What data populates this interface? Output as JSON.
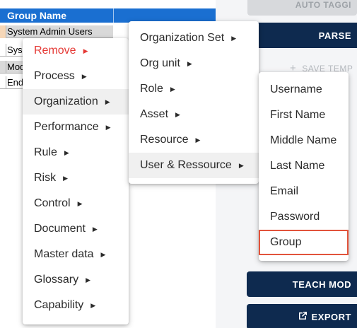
{
  "sheet": {
    "header": "Group Name",
    "rows": [
      "System Admin Users",
      "Sys",
      "Mod",
      "End"
    ]
  },
  "panel": {
    "auto_tagging_label": "AUTO TAGGI",
    "parse_label": "PARSE",
    "save_template_label": "SAVE TEMP",
    "teach_label": "TEACH MOD",
    "export_label": "EXPORT"
  },
  "menus": {
    "main": [
      {
        "label": "Remove",
        "style": "danger"
      },
      {
        "label": "Process"
      },
      {
        "label": "Organization",
        "hover": true
      },
      {
        "label": "Performance"
      },
      {
        "label": "Rule"
      },
      {
        "label": "Risk"
      },
      {
        "label": "Control"
      },
      {
        "label": "Document"
      },
      {
        "label": "Master data"
      },
      {
        "label": "Glossary"
      },
      {
        "label": "Capability"
      }
    ],
    "organization": [
      {
        "label": "Organization Set"
      },
      {
        "label": "Org unit"
      },
      {
        "label": "Role"
      },
      {
        "label": "Asset"
      },
      {
        "label": "Resource"
      },
      {
        "label": "User & Ressource",
        "hover": true
      }
    ],
    "user_resource": [
      {
        "label": "Username"
      },
      {
        "label": "First Name"
      },
      {
        "label": "Middle Name"
      },
      {
        "label": "Last Name"
      },
      {
        "label": "Email"
      },
      {
        "label": "Password"
      },
      {
        "label": "Group",
        "selected": true
      }
    ]
  },
  "colors": {
    "header_blue": "#1a6fd1",
    "dark_button": "#0e2a4f",
    "danger_red": "#e53935",
    "highlight_border": "#e2533b"
  }
}
